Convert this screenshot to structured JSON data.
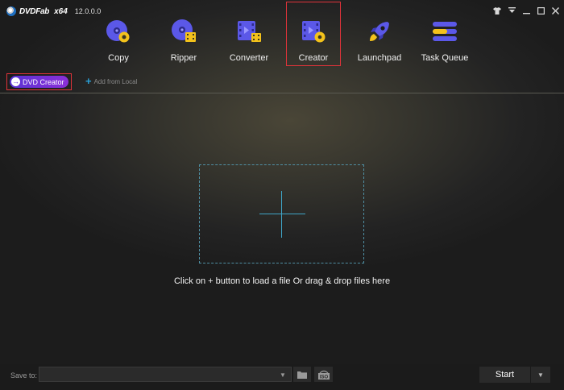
{
  "app": {
    "brand": "DVDFab",
    "arch": "x64",
    "version": "12.0.0.0"
  },
  "nav": [
    {
      "id": "copy",
      "label": "Copy"
    },
    {
      "id": "ripper",
      "label": "Ripper"
    },
    {
      "id": "converter",
      "label": "Converter"
    },
    {
      "id": "creator",
      "label": "Creator",
      "active": true
    },
    {
      "id": "launchpad",
      "label": "Launchpad"
    },
    {
      "id": "task-queue",
      "label": "Task Queue"
    }
  ],
  "subbar": {
    "mode_label": "DVD Creator",
    "add_label": "Add from Local"
  },
  "main": {
    "hint": "Click on + button to load a file Or drag & drop files here"
  },
  "footer": {
    "save_to_label": "Save to:",
    "save_to_value": "",
    "start_label": "Start"
  },
  "colors": {
    "accent_red": "#e0333a",
    "accent_purple": "#6a30d8",
    "accent_cyan": "#3fa4c6"
  }
}
